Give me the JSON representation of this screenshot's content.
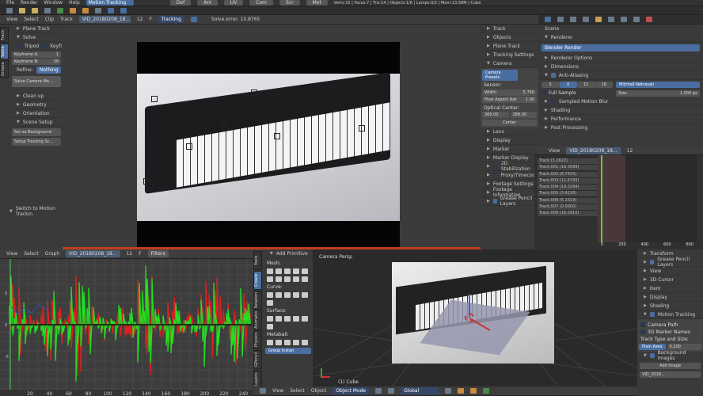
{
  "topbar": {
    "menus": [
      "File",
      "Render",
      "Window",
      "Help"
    ],
    "layout": "Motion Tracking",
    "screens": [
      "Def",
      "Ani",
      "UV",
      "Com",
      "Scr",
      "Mot"
    ],
    "stats": "Verts:15 | Faces:7 | Tris:14 | Objects:1/6 | Lamps:0/2 | Mem:13.58M | Cube"
  },
  "clip_header": {
    "menus": [
      "View",
      "Select",
      "Clip",
      "Track"
    ],
    "clip": "VID_20180208_18...",
    "frame": "12",
    "f": "F",
    "mode": "Tracking",
    "solve_error": "Solve error: 10.8765"
  },
  "toolshelf": {
    "tabs": [
      "Track",
      "Solve",
      "Grease"
    ],
    "plane_track": "Plane Track",
    "solve": "Solve",
    "tripod": "Tripod",
    "keyframe": "Keyfr",
    "keyframe_a_label": "Keyframe A:",
    "keyframe_a": "1",
    "keyframe_b_label": "Keyframe B:",
    "keyframe_b": "39",
    "refine_label": "Refine:",
    "refine": "Nothing",
    "solve_btn": "Solve Camera Mo...",
    "cleanup": "Clean up",
    "geometry": "Geometry",
    "orientation": "Orientation",
    "scene_setup": "Scene Setup",
    "set_bg": "Set as Background",
    "setup_tracking": "Setup Tracking Sc...",
    "switch": "Switch to Motion Trackin"
  },
  "clip_props": {
    "items_top": [
      "Track",
      "Objects",
      "Plane Track",
      "Tracking Settings"
    ],
    "camera": "Camera",
    "presets": "Camera Presets",
    "sensor": "Sensor:",
    "width_label": "Width:",
    "width": "5.760",
    "aspect_label": "Pixel Aspect Rat:",
    "aspect": "1.00",
    "optical": "Optical Center:",
    "ox": "360.00",
    "oy": "288.00",
    "center": "Center",
    "items_bottom": [
      "Lens",
      "Display",
      "Marker",
      "Marker Display",
      "2D Stabilization",
      "Proxy/Timecode",
      "Footage Settings",
      "Footage Information",
      "Grease Pencil Layers"
    ]
  },
  "properties": {
    "scene": "Scene",
    "renderer": "Renderer",
    "engine": "Blender Render",
    "renderer_options": "Renderer Options",
    "dimensions": "Dimensions",
    "aa": "Anti-Aliasing",
    "samples": [
      "5",
      "8",
      "11",
      "16"
    ],
    "filter": "Mitchell-Netravali",
    "full_sample": "Full Sample",
    "size_label": "Size:",
    "size": "1.000 px",
    "motion_blur": "Sampled Motion Blur",
    "shading": "Shading",
    "performance": "Performance",
    "post": "Post Processing"
  },
  "dopesheet": {
    "view": "View",
    "clip": "VID_20180208_18...",
    "frame": "12",
    "tracks": [
      "Track (3.2622)",
      "Track.001 (16.3599)",
      "Track.002 (8.7415)",
      "Track.003 (11.6793)",
      "Track.004 (19.3294)",
      "Track.005 (3.4216)",
      "Track.006 (5.2319)",
      "Track.007 (0.0000)",
      "Track.008 (16.2910)"
    ],
    "ticks": [
      "0",
      "200",
      "400",
      "600",
      "800"
    ]
  },
  "graph": {
    "menus": [
      "View",
      "Select",
      "Graph"
    ],
    "clip": "VID_20180208_18...",
    "frame": "12",
    "f": "F",
    "filters": "Filters",
    "yticks": [
      "5",
      "0",
      "-5"
    ],
    "xticks": [
      "20",
      "40",
      "60",
      "80",
      "100",
      "120",
      "140",
      "160",
      "180",
      "200",
      "220",
      "240"
    ]
  },
  "tools3d": {
    "tabs": [
      "Tools",
      "Create",
      "Relation",
      "Animatio",
      "Physics",
      "GPencil",
      "Layers"
    ],
    "title": "Add Primitive",
    "mesh": "Mesh:",
    "curve": "Curve:",
    "surface": "Surface:",
    "metaball": "Metaball:",
    "group": "Group Instan"
  },
  "view3d": {
    "label": "Camera Persp",
    "object": "(1) Cube",
    "menus": [
      "View",
      "Select",
      "Object"
    ],
    "mode": "Object Mode",
    "orientation": "Global"
  },
  "props3d": {
    "items": [
      "Transform",
      "Grease Pencil Layers",
      "View",
      "3D Cursor",
      "Item",
      "Display",
      "Shading",
      "Motion Tracking"
    ],
    "camera_path": "Camera Path",
    "marker_names": "3D Marker Names",
    "track_type": "Track Type and Size:",
    "axes": "Plain Axes",
    "axes_size": "0.200",
    "bg": "Background Images",
    "add_image": "Add Image",
    "image": "VID_2018..."
  },
  "colors": {
    "accent": "#4a6ea0",
    "x_curve": "#e02020",
    "y_curve": "#20e020"
  }
}
